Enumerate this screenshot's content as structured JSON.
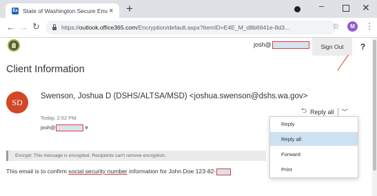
{
  "browser": {
    "tab_title": "State of Washington Secure Ema",
    "tab_favicon_letter": "Ea",
    "new_tab": "+",
    "window_controls": {
      "minimize": "–",
      "close": "✕"
    },
    "url_prefix": "https://",
    "url_host": "outlook.office365.com",
    "url_path": "/Encryption/default.aspx?itemID=E4E_M_d8b6941e-8d3...",
    "profile_initial": "M"
  },
  "header": {
    "user_email": "josh@",
    "sign_out": "Sign Out",
    "help": "?"
  },
  "main": {
    "title": "Client Information",
    "avatar_initials": "SD",
    "sender": "Swenson, Joshua D (DSHS/ALTSA/MSD) <joshua.swenson@dshs.wa.gov>",
    "reply_all_label": "Reply all",
    "date": "Today, 2:52 PM",
    "to_label": "josh@",
    "to_suffix": "¥",
    "encryption_notice": "Encrypt: This message is encrypted. Recipients can't remove encryption.",
    "body_part1": "This email is to confirm ",
    "body_highlight": "social security number",
    "body_part2": " information for John Doe 123-82-"
  },
  "dropdown": {
    "items": [
      "Reply",
      "Reply all",
      "Forward",
      "Print"
    ],
    "selected": "Reply all"
  },
  "colors": {
    "avatar": "#d24726",
    "annotation": "#e03b2f",
    "menu_highlight": "#cce1f1"
  }
}
